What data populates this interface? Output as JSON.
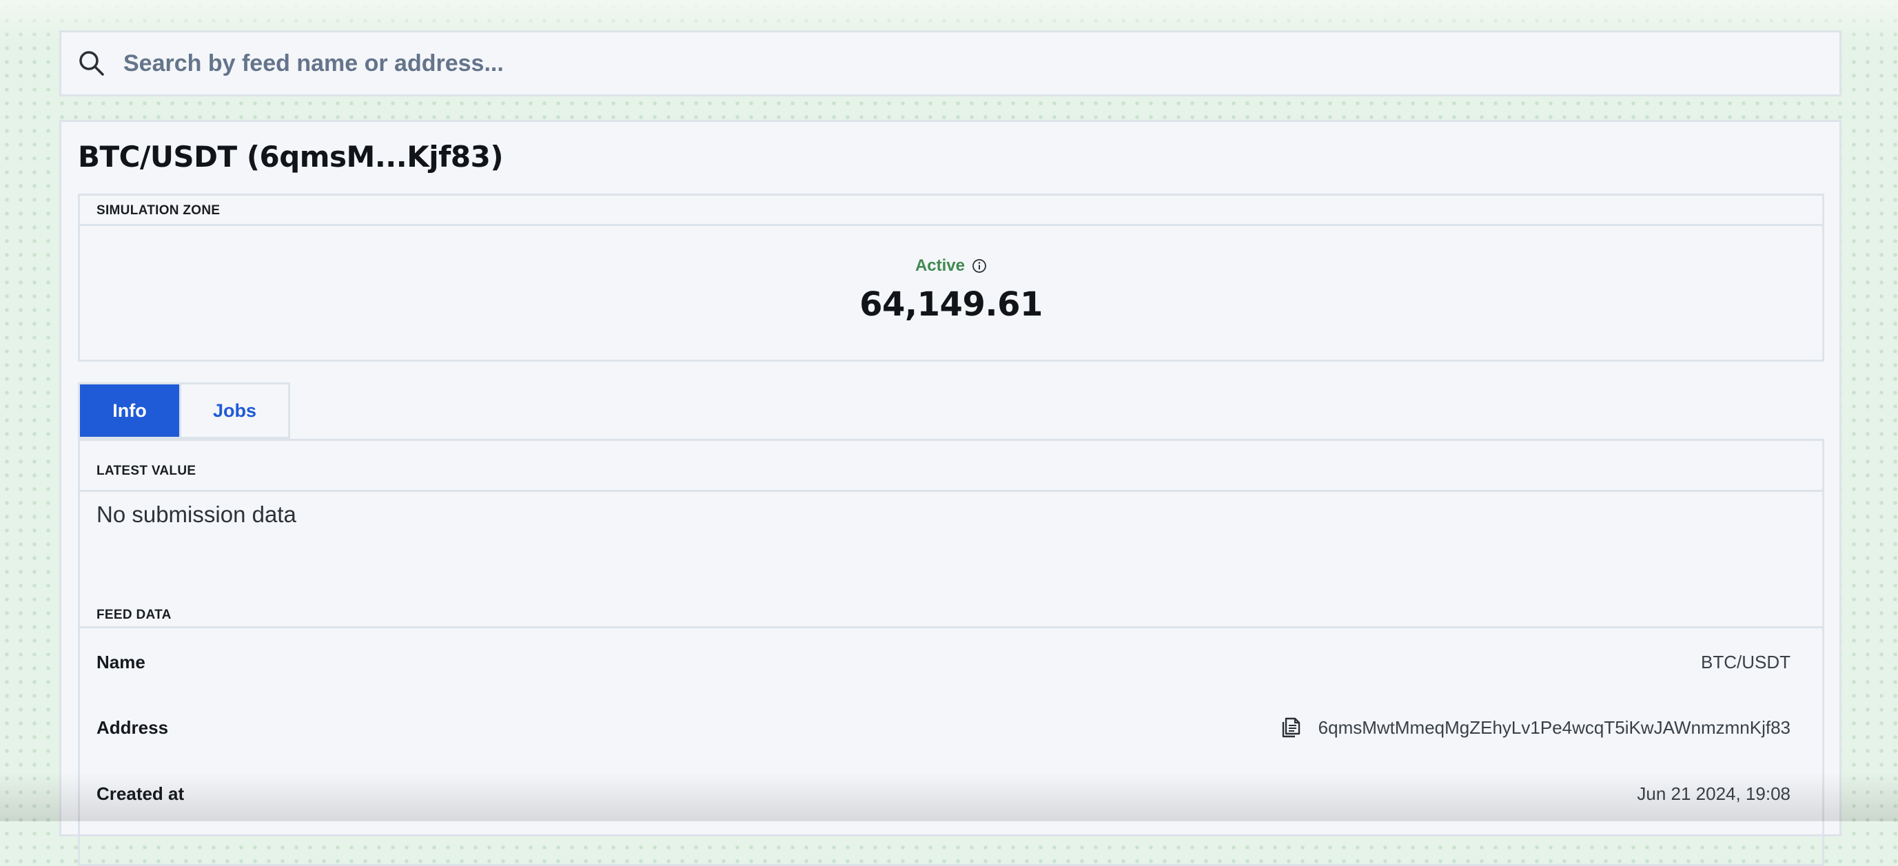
{
  "search": {
    "placeholder": "Search by feed name or address..."
  },
  "feed": {
    "title": "BTC/USDT (6qmsM...Kjf83)"
  },
  "simulation": {
    "label": "SIMULATION ZONE",
    "status": "Active",
    "status_color": "#3f8a4f",
    "value": "64,149.61"
  },
  "tabs": [
    {
      "label": "Info",
      "active": true
    },
    {
      "label": "Jobs",
      "active": false
    }
  ],
  "latest_value": {
    "label": "LATEST VALUE",
    "text": "No submission data"
  },
  "feed_data": {
    "label": "FEED DATA",
    "rows": [
      {
        "label": "Name",
        "value": "BTC/USDT"
      },
      {
        "label": "Address",
        "value": "6qmsMwtMmeqMgZEhyLv1Pe4wcqT5iKwJAWnmzmnKjf83",
        "icon": "copy-icon"
      },
      {
        "label": "Created at",
        "value": "Jun 21 2024, 19:08"
      }
    ]
  },
  "colors": {
    "accent": "#1f5bd6",
    "panel_bg": "#f4f6f9",
    "border": "#dde3ea",
    "page_bg": "#e6f3e8"
  }
}
